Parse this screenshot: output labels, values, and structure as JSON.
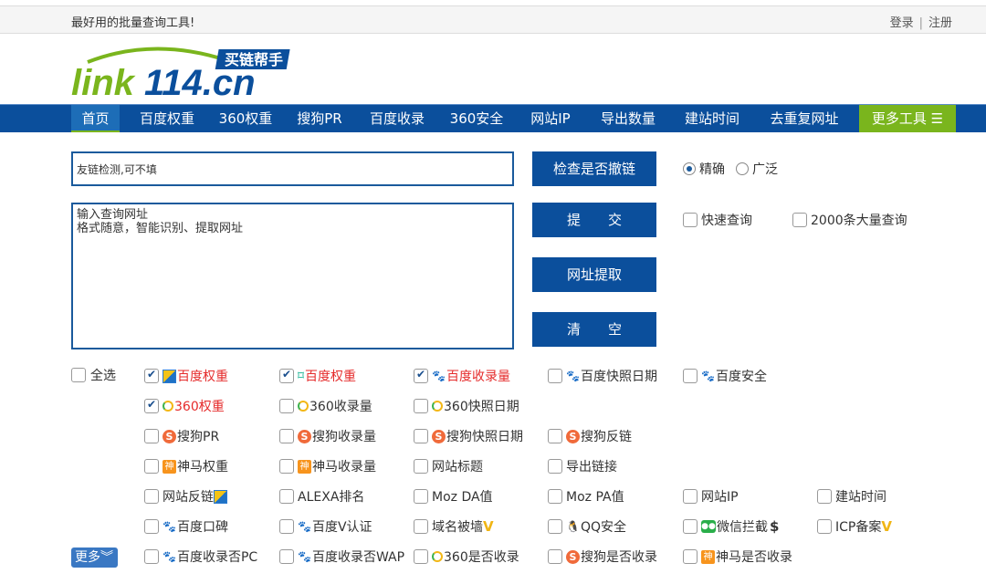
{
  "topbar": {
    "slogan": "最好用的批量查询工具!",
    "login": "登录",
    "separator": "|",
    "register": "注册"
  },
  "logo": {
    "text": "link114.cn",
    "badge": "买链帮手"
  },
  "nav": {
    "items": [
      "首页",
      "百度权重",
      "360权重",
      "搜狗PR",
      "百度收录",
      "360安全",
      "网站IP",
      "导出数量",
      "建站时间",
      "去重复网址"
    ],
    "more": "更多工具"
  },
  "form": {
    "link_check_value": "友链检测,可不填",
    "url_area_value": "输入查询网址\n格式随意，智能识别、提取网址",
    "buttons": {
      "check": "检查是否撤链",
      "submit": "提　　交",
      "extract": "网址提取",
      "clear": "清　　空"
    },
    "match_mode": {
      "exact": "精确",
      "broad": "广泛",
      "selected": "exact"
    },
    "fast_query": "快速查询",
    "bulk_query": "2000条大量查询"
  },
  "options": {
    "select_all": "全选",
    "more": "更多",
    "rows": [
      [
        {
          "label": "百度权重",
          "icon": "aizhan-icon",
          "checked": true,
          "red": true
        },
        {
          "label": "百度权重",
          "icon": "chinaz-icon",
          "checked": true,
          "red": true
        },
        {
          "label": "百度收录量",
          "icon": "baidu-paw-icon",
          "checked": true,
          "red": true
        },
        {
          "label": "百度快照日期",
          "icon": "baidu-paw-icon"
        },
        {
          "label": "百度安全",
          "icon": "baidu-paw-icon"
        }
      ],
      [
        {
          "label": "360权重",
          "icon": "360-icon",
          "checked": true,
          "red": true
        },
        {
          "label": "360收录量",
          "icon": "360-icon"
        },
        {
          "label": "360快照日期",
          "icon": "360-icon"
        }
      ],
      [
        {
          "label": "搜狗PR",
          "icon": "sogou-icon"
        },
        {
          "label": "搜狗收录量",
          "icon": "sogou-icon"
        },
        {
          "label": "搜狗快照日期",
          "icon": "sogou-icon"
        },
        {
          "label": "搜狗反链",
          "icon": "sogou-icon"
        }
      ],
      [
        {
          "label": "神马权重",
          "icon": "shenma-icon"
        },
        {
          "label": "神马收录量",
          "icon": "shenma-icon"
        },
        {
          "label": "网站标题"
        },
        {
          "label": "导出链接"
        }
      ],
      [
        {
          "label": "网站反链",
          "icon_after": "aizhan-icon"
        },
        {
          "label": "ALEXA排名"
        },
        {
          "label": "Moz DA值"
        },
        {
          "label": "Moz PA值"
        },
        {
          "label": "网站IP"
        },
        {
          "label": "建站时间"
        }
      ],
      [
        {
          "label": "百度口碑",
          "icon": "baidu-paw-icon"
        },
        {
          "label": "百度V认证",
          "icon": "baidu-paw-icon"
        },
        {
          "label": "域名被墙",
          "icon_after": "vip-v-icon"
        },
        {
          "label": "QQ安全",
          "icon": "qq-penguin-icon"
        },
        {
          "label": "微信拦截",
          "icon": "wechat-icon",
          "icon_after": "dollar-icon"
        },
        {
          "label": "ICP备案",
          "icon_after": "vip-v-icon"
        }
      ],
      [
        {
          "label": "百度收录否PC",
          "icon": "baidu-paw-icon"
        },
        {
          "label": "百度收录否WAP",
          "icon": "baidu-paw-icon"
        },
        {
          "label": "360是否收录",
          "icon": "360-icon"
        },
        {
          "label": "搜狗是否收录",
          "icon": "sogou-icon"
        },
        {
          "label": "神马是否收录",
          "icon": "shenma-icon"
        }
      ]
    ]
  }
}
